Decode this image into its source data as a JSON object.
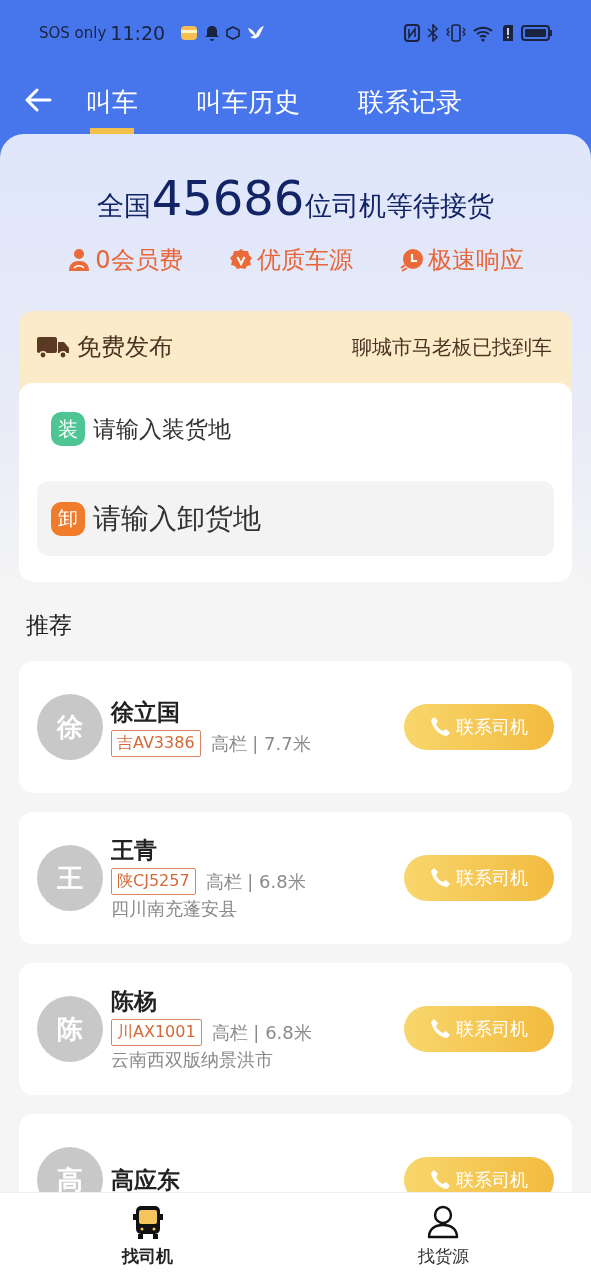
{
  "status_bar": {
    "carrier": "SOS only",
    "time": "11:20"
  },
  "tabs": [
    {
      "label": "叫车",
      "selected": true
    },
    {
      "label": "叫车历史",
      "selected": false
    },
    {
      "label": "联系记录",
      "selected": false
    }
  ],
  "headline": {
    "prefix": "全国",
    "count": "45686",
    "suffix": "位司机等待接货"
  },
  "features": [
    {
      "label": "0会员费"
    },
    {
      "label": "优质车源"
    },
    {
      "label": "极速响应"
    }
  ],
  "publish": {
    "title": "免费发布",
    "notice": "聊城市马老板已找到车",
    "fields": [
      {
        "badge": "装",
        "placeholder": "请输入装货地",
        "color": "#4fc596",
        "focused": false
      },
      {
        "badge": "卸",
        "placeholder": "请输入卸货地",
        "color": "#ef7b2b",
        "focused": true
      }
    ]
  },
  "section_title": "推荐",
  "drivers": [
    {
      "avatar": "徐",
      "name": "徐立国",
      "plate": "吉AV3386",
      "spec": "高栏 | 7.7米",
      "button": "联系司机"
    },
    {
      "avatar": "王",
      "name": "王青",
      "plate": "陕CJ5257",
      "spec": "高栏 | 6.8米",
      "location": "四川南充蓬安县",
      "button": "联系司机"
    },
    {
      "avatar": "陈",
      "name": "陈杨",
      "plate": "川AX1001",
      "spec": "高栏 | 6.8米",
      "location": "云南西双版纳景洪市",
      "button": "联系司机"
    },
    {
      "avatar": "高",
      "name": "高应东",
      "button": "联系司机"
    }
  ],
  "bottom_nav": [
    {
      "label": "找司机",
      "selected": true
    },
    {
      "label": "找货源",
      "selected": false
    }
  ]
}
